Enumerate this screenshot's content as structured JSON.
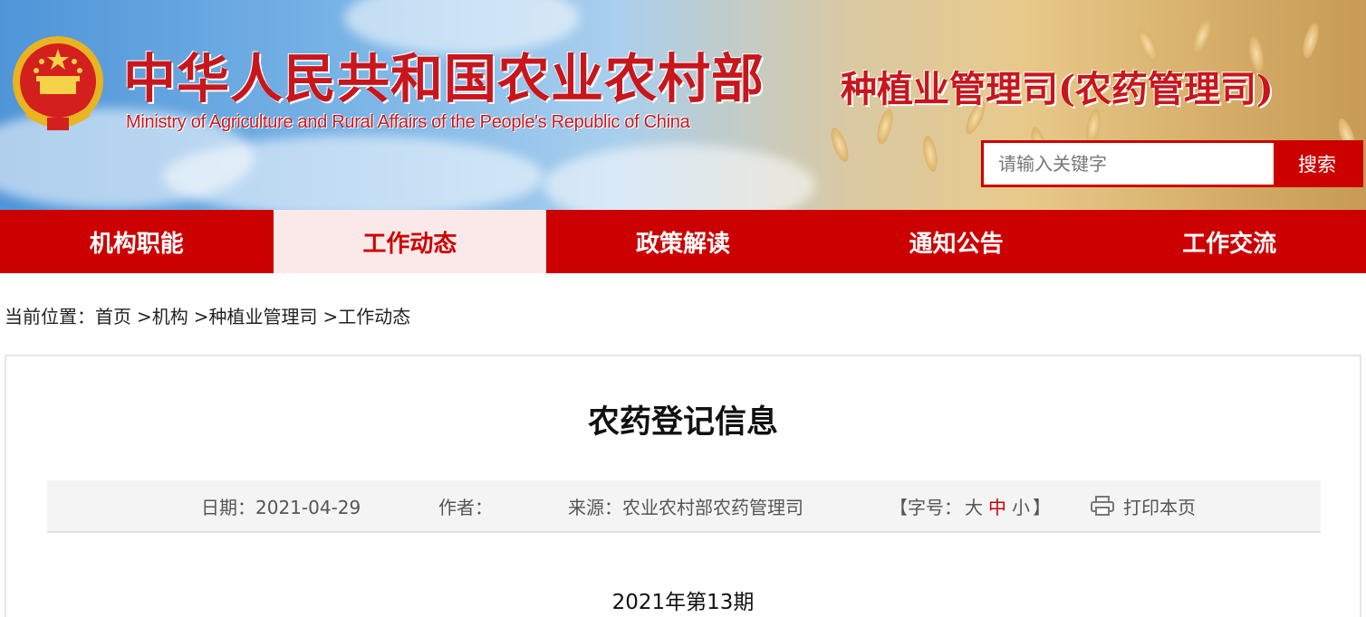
{
  "header": {
    "title_cn": "中华人民共和国农业农村部",
    "title_en": "Ministry of Agriculture and Rural Affairs of the People's Republic of China",
    "dept_title": "种植业管理司(农药管理司)",
    "emblem_icon": "national-emblem-icon",
    "search": {
      "placeholder": "请输入关键字",
      "button_label": "搜索"
    },
    "brand_color": "#c8161d"
  },
  "nav": {
    "items": [
      {
        "label": "机构职能"
      },
      {
        "label": "工作动态",
        "active": true
      },
      {
        "label": "政策解读"
      },
      {
        "label": "通知公告"
      },
      {
        "label": "工作交流"
      }
    ],
    "bg_color": "#cc0000",
    "active_bg_color": "#fbe9ea"
  },
  "breadcrumb": {
    "prefix": "当前位置：",
    "items": [
      "首页",
      "机构",
      "种植业管理司",
      "工作动态"
    ],
    "separator": ">"
  },
  "article": {
    "title": "农药登记信息",
    "meta": {
      "date": "日期：2021-04-29",
      "author": "作者：",
      "source": "来源：农业农村部农药管理司",
      "fontsize_open": "【字号：",
      "fontsize_options": [
        "大",
        "中",
        "小"
      ],
      "fontsize_close": "】",
      "print_label": "打印本页",
      "print_icon": "printer-icon"
    },
    "issue": "2021年第13期"
  }
}
